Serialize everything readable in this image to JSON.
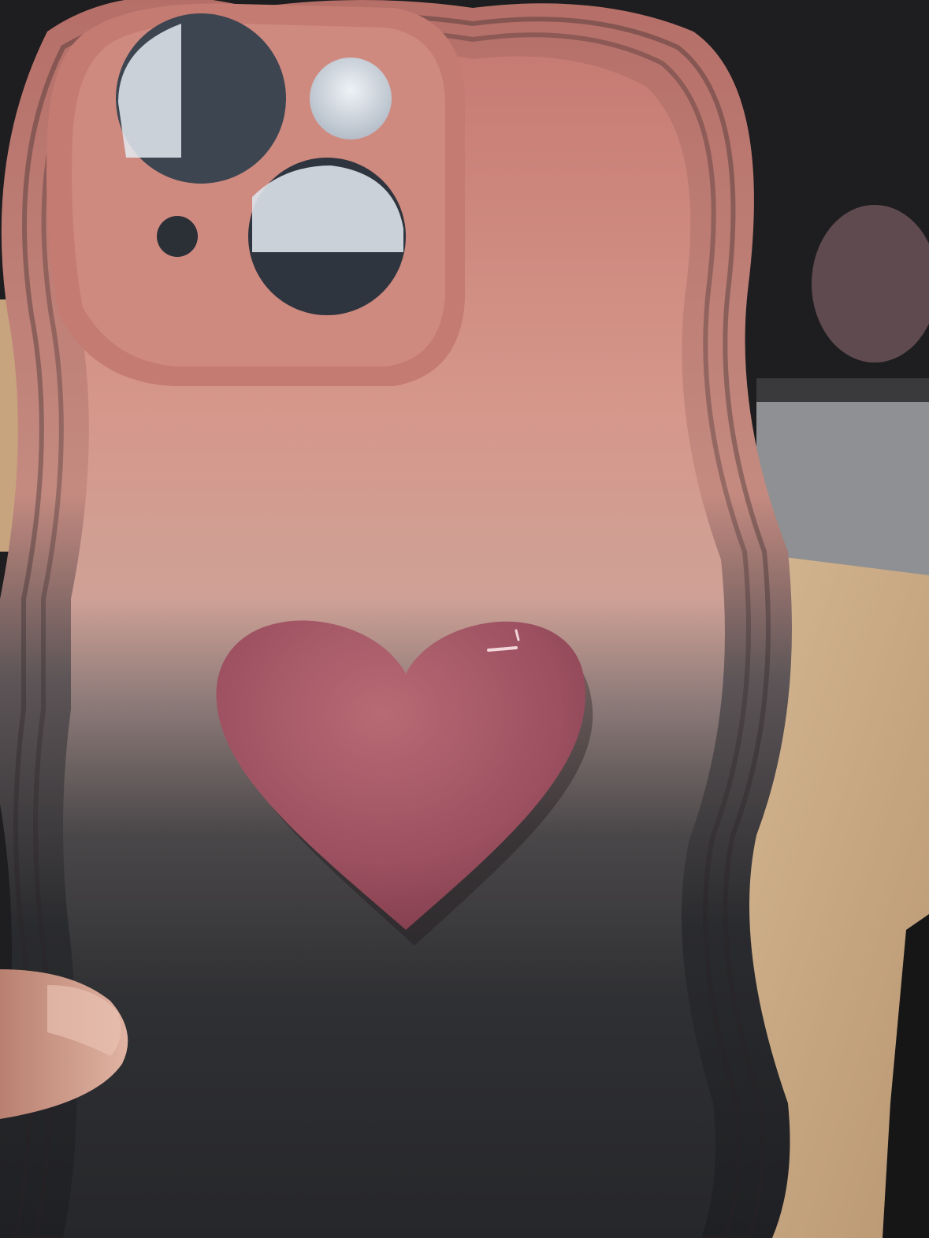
{
  "photo": {
    "subject": "phone-case",
    "colors": {
      "case_pink": "#d08c82",
      "case_pink_light": "#e0a89c",
      "case_dark": "#2c2d30",
      "heart": "#a35460",
      "heart_highlight": "#c17780",
      "lens_glass": "#dfe6ef",
      "desk_wood": "#c9ab84",
      "monitor_frame": "#3a3a3c",
      "background_dark": "#1e1d1f",
      "finger_skin": "#d9a995"
    }
  }
}
